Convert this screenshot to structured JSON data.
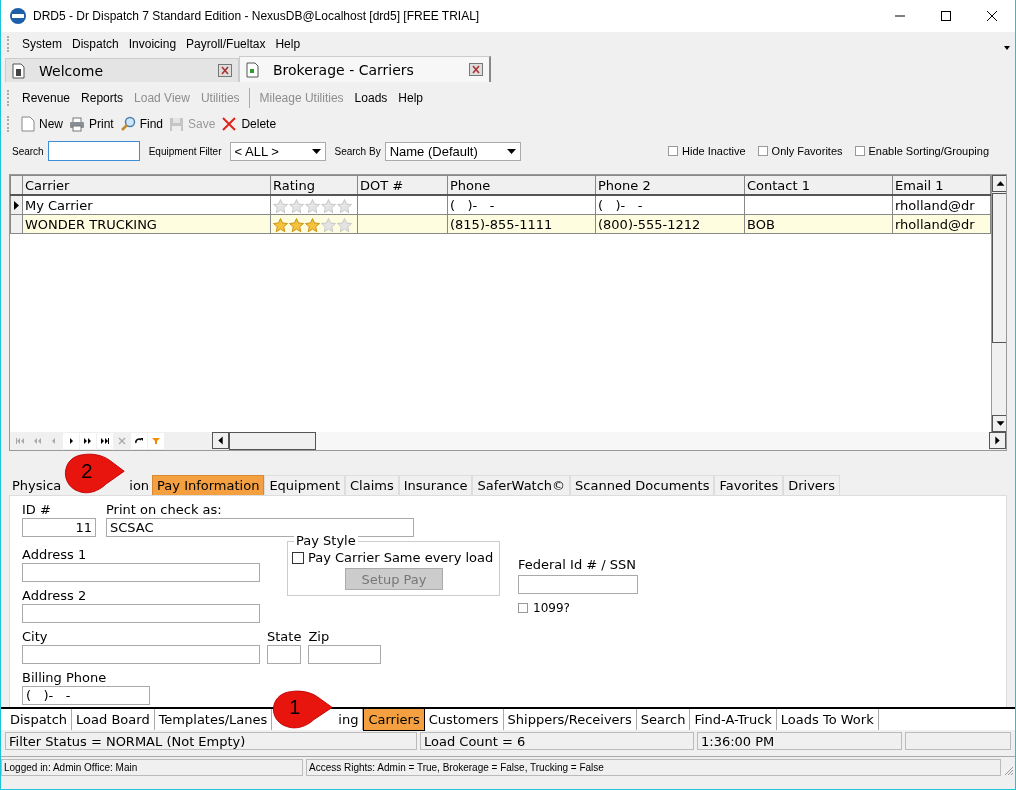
{
  "window": {
    "title": "DRD5 - Dr Dispatch 7 Standard Edition - NexusDB@Localhost [drd5] [FREE TRIAL]"
  },
  "menu": [
    "System",
    "Dispatch",
    "Invoicing",
    "Payroll/Fueltax",
    "Help"
  ],
  "document_tabs": [
    {
      "label": "Welcome",
      "selected": false
    },
    {
      "label": "Brokerage - Carriers",
      "selected": true
    }
  ],
  "submenu": [
    {
      "label": "Revenue",
      "disabled": false
    },
    {
      "label": "Reports",
      "disabled": false
    },
    {
      "label": "Load View",
      "disabled": true
    },
    {
      "label": "Utilities",
      "disabled": true
    },
    {
      "label": "Mileage Utilities",
      "disabled": true,
      "separator_before": true
    },
    {
      "label": "Loads",
      "disabled": false
    },
    {
      "label": "Help",
      "disabled": false
    }
  ],
  "toolbar": [
    {
      "kind": "new",
      "label": "New",
      "disabled": false
    },
    {
      "kind": "print",
      "label": "Print",
      "disabled": false
    },
    {
      "kind": "find",
      "label": "Find",
      "disabled": false
    },
    {
      "kind": "save",
      "label": "Save",
      "disabled": true
    },
    {
      "kind": "delete",
      "label": "Delete",
      "disabled": false
    }
  ],
  "search": {
    "label": "Search",
    "equipment_filter_label": "Equipment Filter",
    "equipment_filter": "< ALL >",
    "search_by_label": "Search By",
    "search_by": "Name (Default)"
  },
  "options": [
    {
      "label": "Hide Inactive",
      "checked": false
    },
    {
      "label": "Only Favorites",
      "checked": false
    },
    {
      "label": "Enable Sorting/Grouping",
      "checked": false
    }
  ],
  "table": {
    "columns": [
      "Carrier",
      "Rating",
      "DOT #",
      "Phone",
      "Phone 2",
      "Contact 1",
      "Email 1"
    ],
    "rows": [
      {
        "current": true,
        "highlighted": false,
        "carrier": "My Carrier",
        "stars": 0,
        "phone": "(   )-   -",
        "phone_2": "(   )-   -",
        "email_1": "rholland@dr"
      },
      {
        "current": false,
        "highlighted": true,
        "carrier": "WONDER TRUCKING",
        "stars": 3,
        "phone": "(815)-855-1111",
        "phone_2": "(800)-555-1212",
        "contact_1": "BOB",
        "email_1": "rholland@dr"
      }
    ]
  },
  "navigator": [
    {
      "kind": "first",
      "disabled": true
    },
    {
      "kind": "prior-page",
      "disabled": true
    },
    {
      "kind": "prior",
      "disabled": true
    },
    {
      "kind": "next",
      "disabled": false
    },
    {
      "kind": "next-page",
      "disabled": false
    },
    {
      "kind": "last",
      "disabled": false
    },
    {
      "kind": "cancel",
      "disabled": true
    },
    {
      "kind": "refresh",
      "disabled": false
    },
    {
      "kind": "filter",
      "disabled": false
    }
  ],
  "detail_tabs": {
    "callout": "2",
    "tabs": [
      {
        "label": "Physica",
        "label_end": "ion",
        "selected": false
      },
      {
        "label": "Pay Information",
        "selected": true
      },
      {
        "label": "Equipment",
        "selected": false
      },
      {
        "label": "Claims",
        "selected": false
      },
      {
        "label": "Insurance",
        "selected": false
      },
      {
        "label": "SaferWatch©",
        "selected": false
      },
      {
        "label": "Scanned Documents",
        "selected": false
      },
      {
        "label": "Favorites",
        "selected": false
      },
      {
        "label": "Drivers",
        "selected": false
      }
    ]
  },
  "form": {
    "id_label": "ID #",
    "id": "11",
    "print_label": "Print on check as:",
    "print_as": "SCSAC",
    "address_1_label": "Address 1",
    "address_2_label": "Address 2",
    "city_label": "City",
    "state_label": "State",
    "zip_label": "Zip",
    "billing_phone_label": "Billing Phone",
    "billing_phone": "(   )-   -",
    "pay_style": {
      "title": "Pay Style",
      "checkbox": {
        "label": "Pay Carrier Same every load",
        "checked": false
      },
      "button": {
        "label": "Setup Pay",
        "disabled": true
      }
    },
    "federal_id_label": "Federal Id # / SSN",
    "form_1099": {
      "label": "1099?",
      "checked": false
    }
  },
  "bottom_tabs": {
    "callout": "1",
    "tabs": [
      {
        "label": "Dispatch",
        "selected": false
      },
      {
        "label": "Load Board",
        "selected": false
      },
      {
        "label": "Templates/Lanes",
        "selected": false
      },
      {
        "label": "ing",
        "selected": false
      },
      {
        "label": "Carriers",
        "selected": true
      },
      {
        "label": "Customers",
        "selected": false
      },
      {
        "label": "Shippers/Receivers",
        "selected": false
      },
      {
        "label": "Search",
        "selected": false
      },
      {
        "label": "Find-A-Truck",
        "selected": false
      },
      {
        "label": "Loads To Work",
        "selected": false
      }
    ]
  },
  "status_bar": [
    "Filter Status = NORMAL (Not Empty)",
    "Load Count = 6",
    "1:36:00 PM"
  ],
  "footer": [
    "Logged in: Admin Office: Main",
    "Access Rights: Admin = True, Brokerage = False, Trucking = False"
  ]
}
